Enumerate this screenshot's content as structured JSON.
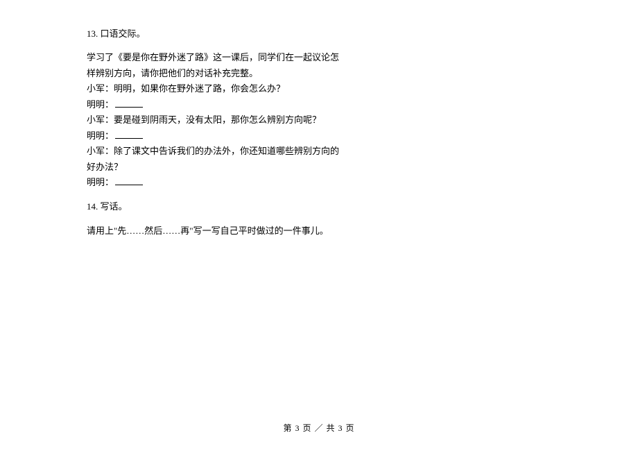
{
  "q13": {
    "header": "13.  口语交际。",
    "lines": [
      "学习了《要是你在野外迷了路》这一课后，同学们在一起议论怎",
      "样辨别方向，请你把他们的对话补充完整。",
      "小军：明明，如果你在野外迷了路，你会怎么办？",
      "明明：",
      "小军：要是碰到阴雨天，没有太阳，那你怎么辨别方向呢？",
      "明明：",
      "小军：除了课文中告诉我们的办法外，你还知道哪些辨别方向的",
      "好办法？",
      "明明："
    ]
  },
  "q14": {
    "header": "14.  写话。",
    "body": "请用上\"先……然后……再\"写一写自己平时做过的一件事儿。"
  },
  "footer": {
    "text": "第 3 页 ／ 共 3 页"
  }
}
